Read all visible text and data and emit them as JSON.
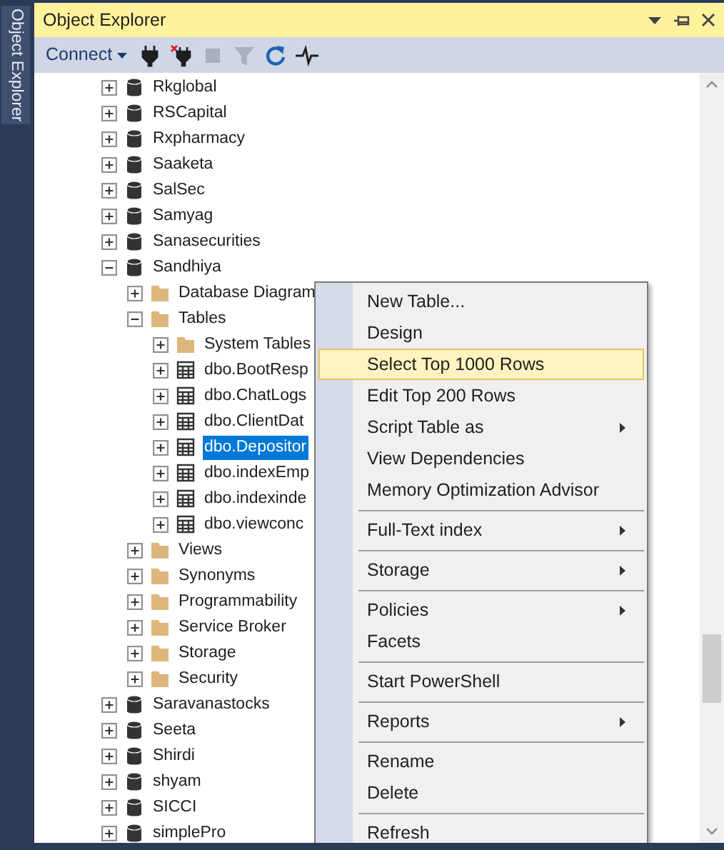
{
  "side_tab": {
    "label": "Object Explorer"
  },
  "panel": {
    "title": "Object Explorer"
  },
  "toolbar": {
    "connect_label": "Connect",
    "buttons": [
      {
        "kind": "connect",
        "disabled": false
      },
      {
        "kind": "disconnect",
        "disabled": false
      },
      {
        "kind": "stop",
        "disabled": true
      },
      {
        "kind": "filter",
        "disabled": true
      },
      {
        "kind": "refresh",
        "disabled": false
      },
      {
        "kind": "activity",
        "disabled": false
      }
    ]
  },
  "tree": [
    {
      "label": "Rkglobal",
      "kind": "database",
      "expanded": false,
      "selected": false
    },
    {
      "label": "RSCapital",
      "kind": "database",
      "expanded": false,
      "selected": false
    },
    {
      "label": "Rxpharmacy",
      "kind": "database",
      "expanded": false,
      "selected": false
    },
    {
      "label": "Saaketa",
      "kind": "database",
      "expanded": false,
      "selected": false
    },
    {
      "label": "SalSec",
      "kind": "database",
      "expanded": false,
      "selected": false
    },
    {
      "label": "Samyag",
      "kind": "database",
      "expanded": false,
      "selected": false
    },
    {
      "label": "Sanasecurities",
      "kind": "database",
      "expanded": false,
      "selected": false
    },
    {
      "label": "Sandhiya",
      "kind": "database",
      "expanded": true,
      "selected": false,
      "children": [
        {
          "label": "Database Diagram",
          "kind": "folder",
          "expanded": false,
          "selected": false
        },
        {
          "label": "Tables",
          "kind": "folder",
          "expanded": true,
          "selected": false,
          "children": [
            {
              "label": "System Tables",
              "kind": "folder",
              "expanded": false,
              "selected": false
            },
            {
              "label": "dbo.BootResp",
              "kind": "table",
              "expanded": false,
              "selected": false
            },
            {
              "label": "dbo.ChatLogs",
              "kind": "table",
              "expanded": false,
              "selected": false
            },
            {
              "label": "dbo.ClientDat",
              "kind": "table",
              "expanded": false,
              "selected": false
            },
            {
              "label": "dbo.Depositor",
              "kind": "table",
              "expanded": false,
              "selected": true
            },
            {
              "label": "dbo.indexEmp",
              "kind": "table",
              "expanded": false,
              "selected": false
            },
            {
              "label": "dbo.indexinde",
              "kind": "table",
              "expanded": false,
              "selected": false
            },
            {
              "label": "dbo.viewconc",
              "kind": "table",
              "expanded": false,
              "selected": false
            }
          ]
        },
        {
          "label": "Views",
          "kind": "folder",
          "expanded": false,
          "selected": false
        },
        {
          "label": "Synonyms",
          "kind": "folder",
          "expanded": false,
          "selected": false
        },
        {
          "label": "Programmability",
          "kind": "folder",
          "expanded": false,
          "selected": false
        },
        {
          "label": "Service Broker",
          "kind": "folder",
          "expanded": false,
          "selected": false
        },
        {
          "label": "Storage",
          "kind": "folder",
          "expanded": false,
          "selected": false
        },
        {
          "label": "Security",
          "kind": "folder",
          "expanded": false,
          "selected": false
        }
      ]
    },
    {
      "label": "Saravanastocks",
      "kind": "database",
      "expanded": false,
      "selected": false
    },
    {
      "label": "Seeta",
      "kind": "database",
      "expanded": false,
      "selected": false
    },
    {
      "label": "Shirdi",
      "kind": "database",
      "expanded": false,
      "selected": false
    },
    {
      "label": "shyam",
      "kind": "database",
      "expanded": false,
      "selected": false
    },
    {
      "label": "SICCI",
      "kind": "database",
      "expanded": false,
      "selected": false
    },
    {
      "label": "simplePro",
      "kind": "database",
      "expanded": false,
      "selected": false
    }
  ],
  "context_menu": {
    "items": [
      {
        "kind": "item",
        "label": "New Table...",
        "submenu": false,
        "selected": false
      },
      {
        "kind": "item",
        "label": "Design",
        "submenu": false,
        "selected": false
      },
      {
        "kind": "item",
        "label": "Select Top 1000 Rows",
        "submenu": false,
        "selected": true
      },
      {
        "kind": "item",
        "label": "Edit Top 200 Rows",
        "submenu": false,
        "selected": false
      },
      {
        "kind": "item",
        "label": "Script Table as",
        "submenu": true,
        "selected": false
      },
      {
        "kind": "item",
        "label": "View Dependencies",
        "submenu": false,
        "selected": false
      },
      {
        "kind": "item",
        "label": "Memory Optimization Advisor",
        "submenu": false,
        "selected": false
      },
      {
        "kind": "separator"
      },
      {
        "kind": "item",
        "label": "Full-Text index",
        "submenu": true,
        "selected": false
      },
      {
        "kind": "separator"
      },
      {
        "kind": "item",
        "label": "Storage",
        "submenu": true,
        "selected": false
      },
      {
        "kind": "separator"
      },
      {
        "kind": "item",
        "label": "Policies",
        "submenu": true,
        "selected": false
      },
      {
        "kind": "item",
        "label": "Facets",
        "submenu": false,
        "selected": false
      },
      {
        "kind": "separator"
      },
      {
        "kind": "item",
        "label": "Start PowerShell",
        "submenu": false,
        "selected": false
      },
      {
        "kind": "separator"
      },
      {
        "kind": "item",
        "label": "Reports",
        "submenu": true,
        "selected": false
      },
      {
        "kind": "separator"
      },
      {
        "kind": "item",
        "label": "Rename",
        "submenu": false,
        "selected": false
      },
      {
        "kind": "item",
        "label": "Delete",
        "submenu": false,
        "selected": false
      },
      {
        "kind": "separator"
      },
      {
        "kind": "item",
        "label": "Refresh",
        "submenu": false,
        "selected": false
      }
    ]
  }
}
